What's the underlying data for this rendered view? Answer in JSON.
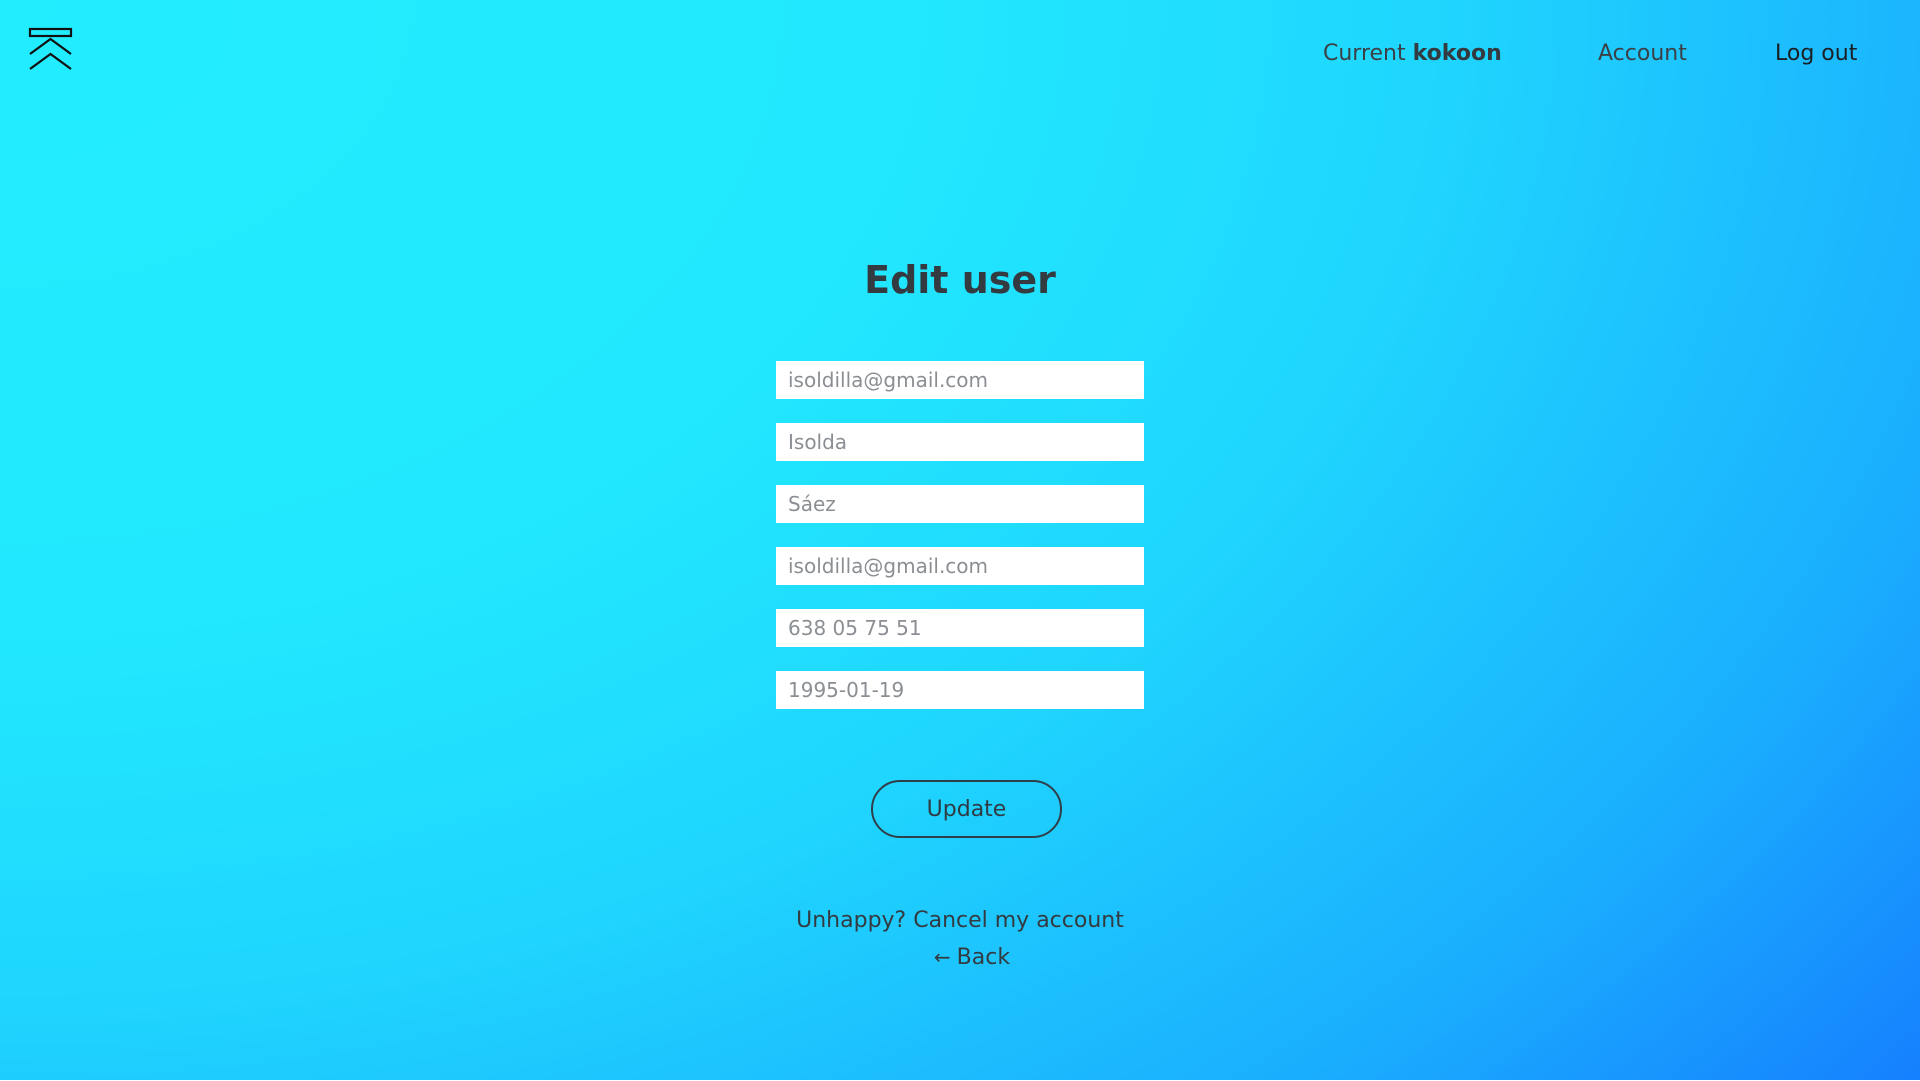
{
  "header": {
    "logo_icon": "kokoon-chevron-logo-icon",
    "current_prefix": "Current",
    "current_name": "kokoon",
    "account_label": "Account",
    "logout_label": "Log out"
  },
  "main": {
    "title": "Edit user",
    "fields": [
      {
        "name": "email",
        "value": "",
        "placeholder": "isoldilla@gmail.com"
      },
      {
        "name": "first-name",
        "value": "",
        "placeholder": "Isolda"
      },
      {
        "name": "last-name",
        "value": "",
        "placeholder": "Sáez"
      },
      {
        "name": "email-confirm",
        "value": "",
        "placeholder": "isoldilla@gmail.com"
      },
      {
        "name": "phone",
        "value": "",
        "placeholder": "638 05 75 51"
      },
      {
        "name": "birthdate",
        "value": "",
        "placeholder": "1995-01-19"
      }
    ],
    "update_label": "Update",
    "cancel_label": "Unhappy? Cancel my account",
    "back_arrow": "←",
    "back_label": "Back"
  },
  "colors": {
    "gradient_start": "#22edff",
    "gradient_end": "#1473fe",
    "text": "#333a40"
  }
}
